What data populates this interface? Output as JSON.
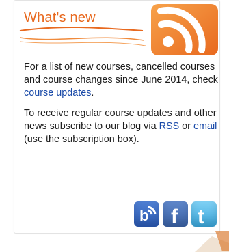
{
  "widget": {
    "title": "What's new",
    "para1": {
      "text_before_link": "For a list of new courses, cancelled courses and course changes since June 2014, check ",
      "link_text": "course updates",
      "text_after_link": "."
    },
    "para2": {
      "text_1": "To receive regular course updates and other news subscribe to our blog via ",
      "link_rss": "RSS",
      "text_2": " or ",
      "link_email": "email",
      "text_3": " (use the subscription box)."
    }
  },
  "social": [
    {
      "name": "blog",
      "icon": "blog-icon"
    },
    {
      "name": "facebook",
      "icon": "facebook-icon"
    },
    {
      "name": "twitter",
      "icon": "twitter-icon"
    }
  ],
  "colors": {
    "accent_orange": "#e8691f",
    "link_blue": "#1a4aa8",
    "body_text": "#1d1d1d"
  }
}
